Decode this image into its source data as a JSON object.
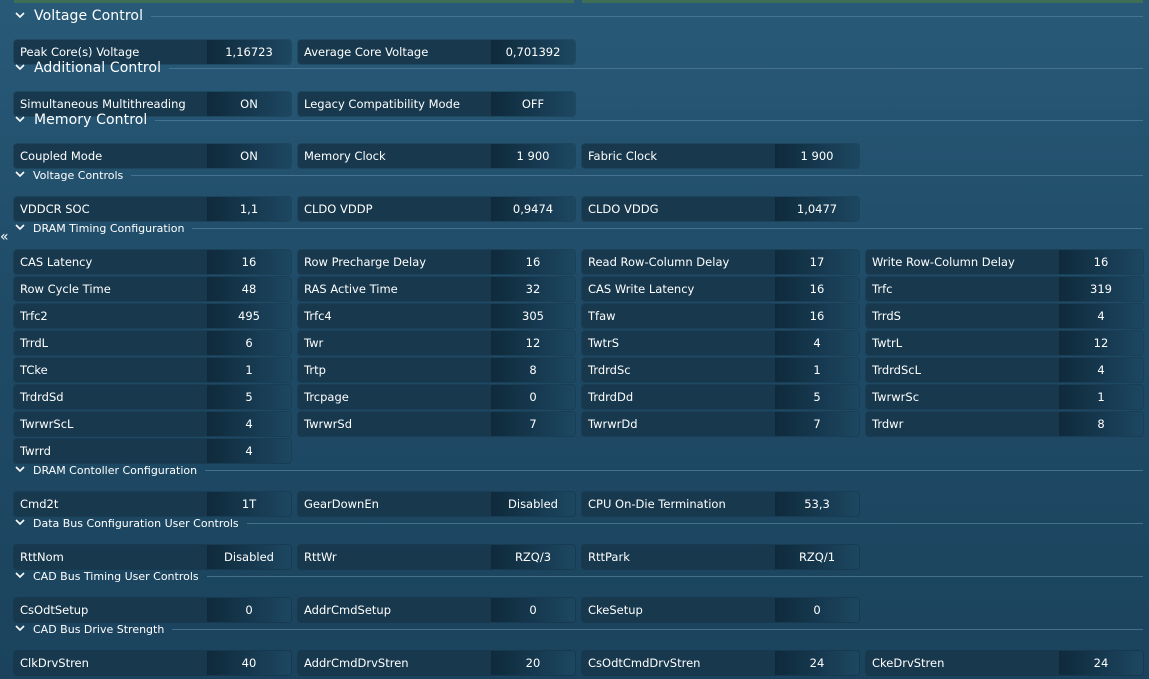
{
  "sections": {
    "voltage_control": {
      "title": "Voltage Control",
      "fields": [
        {
          "label": "Peak Core(s) Voltage",
          "value": "1,16723"
        },
        {
          "label": "Average Core Voltage",
          "value": "0,701392"
        }
      ]
    },
    "additional_control": {
      "title": "Additional Control",
      "fields": [
        {
          "label": "Simultaneous Multithreading",
          "value": "ON"
        },
        {
          "label": "Legacy Compatibility Mode",
          "value": "OFF"
        }
      ]
    },
    "memory_control": {
      "title": "Memory Control",
      "fields": [
        {
          "label": "Coupled Mode",
          "value": "ON"
        },
        {
          "label": "Memory Clock",
          "value": "1 900"
        },
        {
          "label": "Fabric Clock",
          "value": "1 900"
        }
      ]
    },
    "voltage_controls": {
      "title": "Voltage Controls",
      "fields": [
        {
          "label": "VDDCR SOC",
          "value": "1,1"
        },
        {
          "label": "CLDO VDDP",
          "value": "0,9474"
        },
        {
          "label": "CLDO VDDG",
          "value": "1,0477"
        }
      ]
    },
    "dram_timing": {
      "title": "DRAM Timing Configuration",
      "fields": [
        {
          "label": "CAS Latency",
          "value": "16"
        },
        {
          "label": "Row Precharge Delay",
          "value": "16"
        },
        {
          "label": "Read Row-Column Delay",
          "value": "17"
        },
        {
          "label": "Write Row-Column Delay",
          "value": "16"
        },
        {
          "label": "Row Cycle Time",
          "value": "48"
        },
        {
          "label": "RAS Active Time",
          "value": "32"
        },
        {
          "label": "CAS Write Latency",
          "value": "16"
        },
        {
          "label": "Trfc",
          "value": "319"
        },
        {
          "label": "Trfc2",
          "value": "495"
        },
        {
          "label": "Trfc4",
          "value": "305"
        },
        {
          "label": "Tfaw",
          "value": "16"
        },
        {
          "label": "TrrdS",
          "value": "4"
        },
        {
          "label": "TrrdL",
          "value": "6"
        },
        {
          "label": "Twr",
          "value": "12"
        },
        {
          "label": "TwtrS",
          "value": "4"
        },
        {
          "label": "TwtrL",
          "value": "12"
        },
        {
          "label": "TCke",
          "value": "1"
        },
        {
          "label": "Trtp",
          "value": "8"
        },
        {
          "label": "TrdrdSc",
          "value": "1"
        },
        {
          "label": "TrdrdScL",
          "value": "4"
        },
        {
          "label": "TrdrdSd",
          "value": "5"
        },
        {
          "label": "Trcpage",
          "value": "0"
        },
        {
          "label": "TrdrdDd",
          "value": "5"
        },
        {
          "label": "TwrwrSc",
          "value": "1"
        },
        {
          "label": "TwrwrScL",
          "value": "4"
        },
        {
          "label": "TwrwrSd",
          "value": "7"
        },
        {
          "label": "TwrwrDd",
          "value": "7"
        },
        {
          "label": "Trdwr",
          "value": "8"
        },
        {
          "label": "Twrrd",
          "value": "4"
        }
      ]
    },
    "dram_controller": {
      "title": "DRAM Contoller Configuration",
      "fields": [
        {
          "label": "Cmd2t",
          "value": "1T"
        },
        {
          "label": "GearDownEn",
          "value": "Disabled"
        },
        {
          "label": "CPU On-Die Termination",
          "value": "53,3"
        }
      ]
    },
    "data_bus": {
      "title": "Data Bus Configuration User Controls",
      "fields": [
        {
          "label": "RttNom",
          "value": "Disabled"
        },
        {
          "label": "RttWr",
          "value": "RZQ/3"
        },
        {
          "label": "RttPark",
          "value": "RZQ/1"
        }
      ]
    },
    "cad_timing": {
      "title": "CAD Bus Timing User Controls",
      "fields": [
        {
          "label": "CsOdtSetup",
          "value": "0"
        },
        {
          "label": "AddrCmdSetup",
          "value": "0"
        },
        {
          "label": "CkeSetup",
          "value": "0"
        }
      ]
    },
    "cad_drive": {
      "title": "CAD Bus Drive Strength",
      "fields": [
        {
          "label": "ClkDrvStren",
          "value": "40"
        },
        {
          "label": "AddrCmdDrvStren",
          "value": "20"
        },
        {
          "label": "CsOdtCmdDrvStren",
          "value": "24"
        },
        {
          "label": "CkeDrvStren",
          "value": "24"
        }
      ]
    }
  },
  "icons": {
    "section_toggle": "chevron-down-icon",
    "side_panel": "double-chevron-left-icon"
  },
  "colors": {
    "background": "#285a78",
    "label_bg": "#17384d",
    "value_bg": "#0f2a3b",
    "divider": "#4d7a96"
  }
}
